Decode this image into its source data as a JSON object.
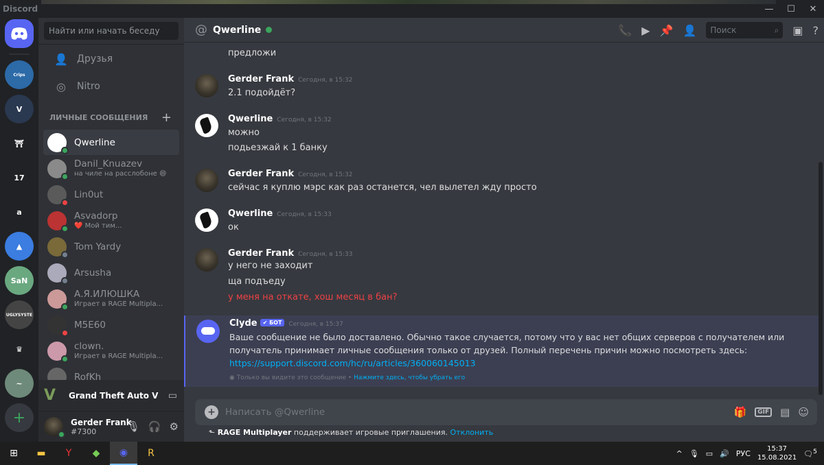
{
  "app": {
    "title": "Discord"
  },
  "window": {
    "controls": [
      "—",
      "☐",
      "✕"
    ]
  },
  "guilds": [
    {
      "label": "Crips",
      "color": "#2c6aa8"
    },
    {
      "label": "V",
      "color": "#2a3850"
    },
    {
      "label": "⛩",
      "color": "#202225"
    },
    {
      "label": "17",
      "color": "#202225"
    },
    {
      "label": "a",
      "color": "#202225"
    },
    {
      "label": "▲",
      "color": "#3b7de0"
    },
    {
      "label": "SaN",
      "color": "#6aa880"
    },
    {
      "label": "UGLYSYSTE",
      "color": "#444"
    },
    {
      "label": "♛",
      "color": "#202225"
    },
    {
      "label": "~",
      "color": "#6e8a7a"
    }
  ],
  "add_server": "+",
  "sidebar": {
    "search_placeholder": "Найти или начать беседу",
    "friends": "Друзья",
    "nitro": "Nitro",
    "dm_header": "ЛИЧНЫЕ СООБЩЕНИЯ",
    "dm_add": "+",
    "dms": [
      {
        "name": "Qwerline",
        "status": "online",
        "sub": "",
        "active": true,
        "avatar": "#ffffff"
      },
      {
        "name": "Danil_Knuazev",
        "status": "online",
        "sub": "на чиле на расслобоне 😄",
        "active": false,
        "avatar": "#8a8a8a"
      },
      {
        "name": "Lin0ut",
        "status": "dnd",
        "sub": "",
        "active": false,
        "avatar": "#5a5a5a"
      },
      {
        "name": "Asvadorp",
        "status": "online",
        "sub": "❤️ Мой тим...",
        "active": false,
        "avatar": "#b33"
      },
      {
        "name": "Tom Yardy",
        "status": "off",
        "sub": "",
        "active": false,
        "avatar": "#7a6a3a"
      },
      {
        "name": "Arsusha",
        "status": "off",
        "sub": "",
        "active": false,
        "avatar": "#aab"
      },
      {
        "name": "А.Я.ИЛЮШКА",
        "status": "online",
        "sub": "Играет в RAGE Multipla...",
        "active": false,
        "avatar": "#c99"
      },
      {
        "name": "M5E60",
        "status": "dnd",
        "sub": "",
        "active": false,
        "avatar": "#333"
      },
      {
        "name": "clown.",
        "status": "online",
        "sub": "Играет в RAGE Multipla...",
        "active": false,
        "avatar": "#c9a"
      },
      {
        "name": "RofKh",
        "status": "off",
        "sub": "",
        "active": false,
        "avatar": "#666"
      }
    ],
    "activity_game": "Grand Theft Auto V",
    "user_name": "Gerder Frank",
    "user_tag": "#7300"
  },
  "chat": {
    "channel": "Qwerline",
    "search_placeholder": "Поиск",
    "messages": {
      "m0": "предложи",
      "g1_author": "Gerder Frank",
      "g1_ts": "Сегодня, в 15:32",
      "g1_l1": "2.1 подойдёт?",
      "q1_author": "Qwerline",
      "q1_ts": "Сегодня, в 15:32",
      "q1_l1": "можно",
      "q1_l2": "подьезжай к 1 банку",
      "g2_author": "Gerder Frank",
      "g2_ts": "Сегодня, в 15:32",
      "g2_l1": "сейчас я куплю мэрс как раз останется, чел вылетел жду просто",
      "q2_author": "Qwerline",
      "q2_ts": "Сегодня, в 15:33",
      "q2_l1": "ок",
      "g3_author": "Gerder Frank",
      "g3_ts": "Сегодня, в 15:33",
      "g3_l1": "у него не заходит",
      "g3_l2": "ща подъеду",
      "g3_l3": "у меня на откате, хош месяц в бан?",
      "c_author": "Clyde",
      "c_badge": "✔ БОТ",
      "c_ts": "Сегодня, в 15:37",
      "c_l1": "Ваше сообщение не было доставлено. Обычно такое случается, потому что у вас нет общих серверов с получателем или",
      "c_l2": "получатель принимает личные сообщения только от друзей. Полный перечень причин можно посмотреть здесь:",
      "c_link": "https://support.discord.com/hc/ru/articles/360060145013",
      "c_eph": "Только вы видите это сообщение •",
      "c_eph_action": "Нажмите здесь, чтобы убрать его"
    },
    "composer_placeholder": "Написать @Qwerline",
    "invite_game": "RAGE Multiplayer",
    "invite_text": "поддерживает игровые приглашения.",
    "invite_action": "Отклонить"
  },
  "taskbar": {
    "lang": "РУС",
    "time": "15:37",
    "date": "15.08.2021",
    "notif": "5"
  }
}
